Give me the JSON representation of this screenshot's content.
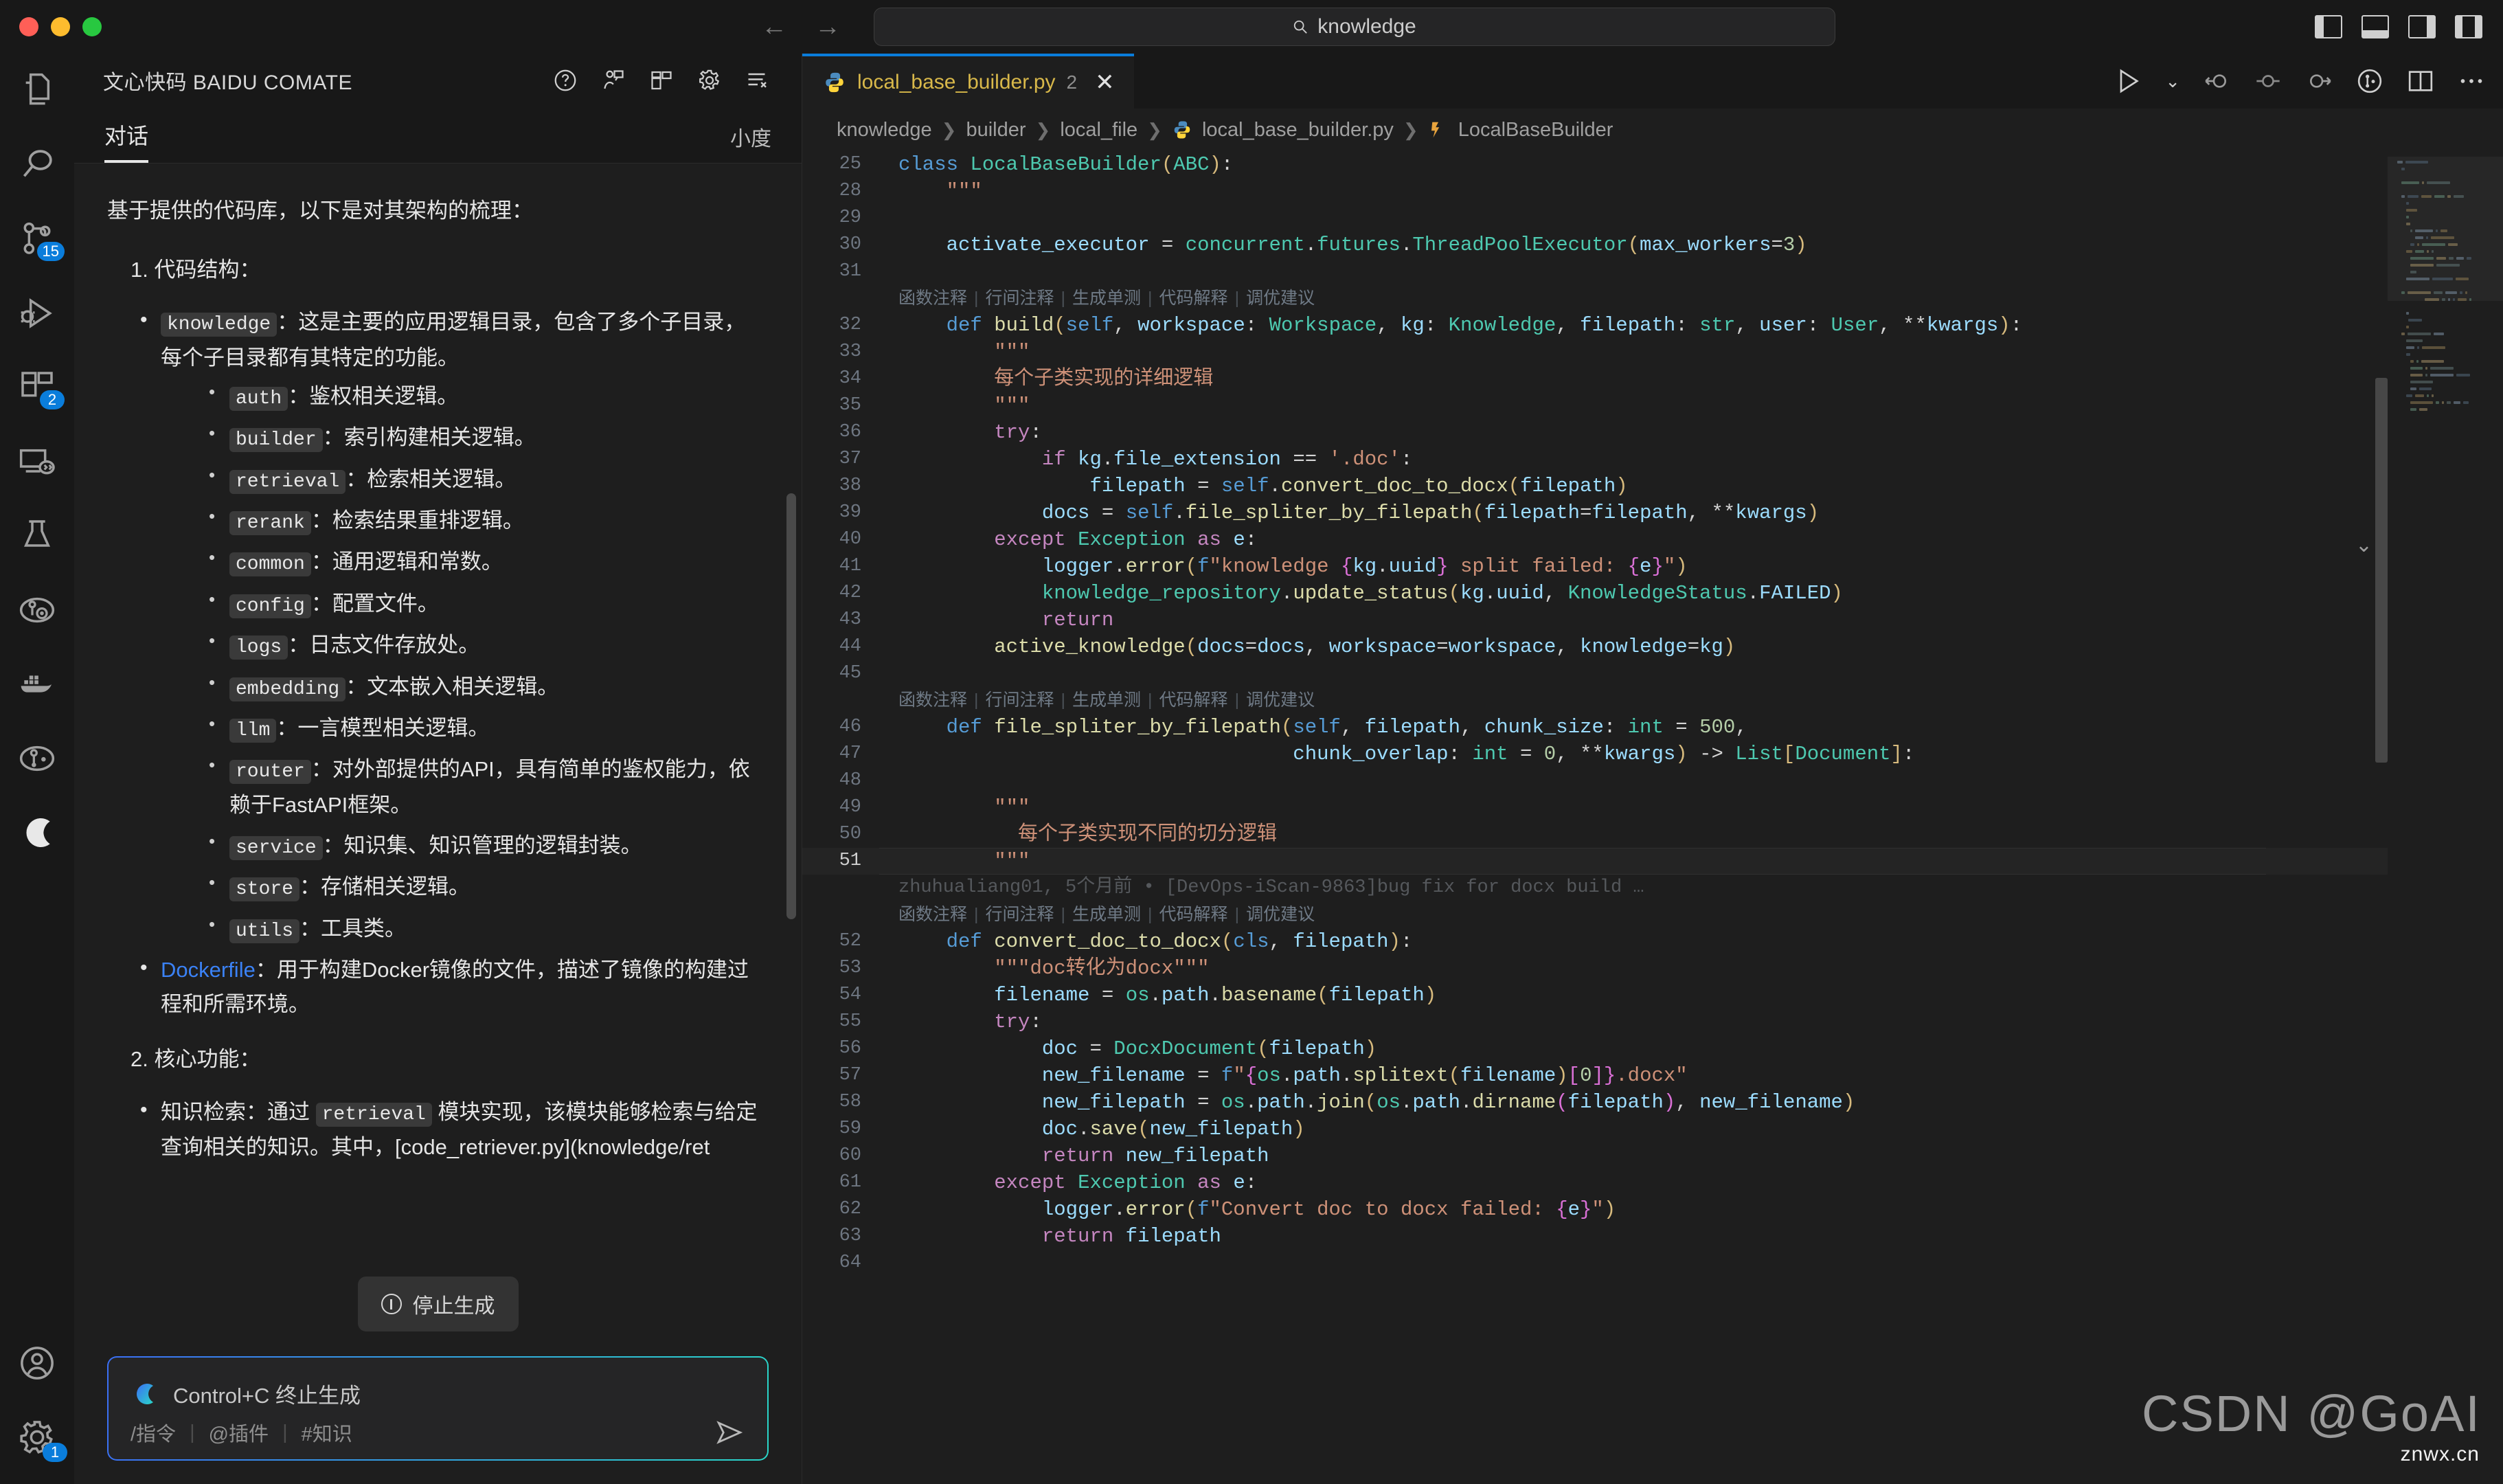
{
  "window": {
    "traffic_lights": [
      "close",
      "minimize",
      "maximize"
    ],
    "nav_back": "←",
    "nav_forward": "→",
    "command_bar": {
      "icon": "search-icon",
      "value": "knowledge"
    },
    "layout_controls": [
      "toggle-primary-sidebar",
      "toggle-panel",
      "toggle-secondary-sidebar",
      "customize-layout"
    ]
  },
  "activity_bar": {
    "items": [
      {
        "name": "explorer",
        "icon": "files-icon",
        "badge": ""
      },
      {
        "name": "search",
        "icon": "search-icon",
        "badge": ""
      },
      {
        "name": "source-control",
        "icon": "source-control-icon",
        "badge": "15"
      },
      {
        "name": "run-and-debug",
        "icon": "debug-icon",
        "badge": ""
      },
      {
        "name": "extensions",
        "icon": "extensions-icon",
        "badge": "2"
      },
      {
        "name": "remote-explorer",
        "icon": "remote-icon",
        "badge": ""
      },
      {
        "name": "testing",
        "icon": "beaker-icon",
        "badge": ""
      },
      {
        "name": "gitlens",
        "icon": "gitlens-icon",
        "badge": ""
      },
      {
        "name": "docker",
        "icon": "docker-icon",
        "badge": ""
      },
      {
        "name": "git-graph",
        "icon": "git-graph-icon",
        "badge": ""
      },
      {
        "name": "comate",
        "icon": "comate-logo-icon",
        "badge": ""
      }
    ],
    "bottom_items": [
      {
        "name": "accounts",
        "icon": "account-icon",
        "badge": ""
      },
      {
        "name": "manage",
        "icon": "gear-icon",
        "badge": "1"
      }
    ]
  },
  "side_panel": {
    "header": {
      "title": "文心快码 BAIDU COMATE",
      "icons": [
        "help-icon",
        "feedback-icon",
        "layout-icon",
        "gear-icon",
        "clear-list-icon"
      ]
    },
    "tabs": {
      "active": "对话",
      "right_label": "小度"
    },
    "conversation": {
      "intro": "基于提供的代码库，以下是对其架构的梳理：",
      "section1_heading": "1. 代码结构：",
      "knowledge_item": {
        "code": "knowledge",
        "text": "：这是主要的应用逻辑目录，包含了多个子目录，每个子目录都有其特定的功能。",
        "children": [
          {
            "code": "auth",
            "text": "：鉴权相关逻辑。"
          },
          {
            "code": "builder",
            "text": "：索引构建相关逻辑。"
          },
          {
            "code": "retrieval",
            "text": "：检索相关逻辑。"
          },
          {
            "code": "rerank",
            "text": "：检索结果重排逻辑。"
          },
          {
            "code": "common",
            "text": "：通用逻辑和常数。"
          },
          {
            "code": "config",
            "text": "：配置文件。"
          },
          {
            "code": "logs",
            "text": "：日志文件存放处。"
          },
          {
            "code": "embedding",
            "text": "：文本嵌入相关逻辑。"
          },
          {
            "code": "llm",
            "text": "：一言模型相关逻辑。"
          },
          {
            "code": "router",
            "text": "：对外部提供的API，具有简单的鉴权能力，依赖于FastAPI框架。"
          },
          {
            "code": "service",
            "text": "：知识集、知识管理的逻辑封装。"
          },
          {
            "code": "store",
            "text": "：存储相关逻辑。"
          },
          {
            "code": "utils",
            "text": "：工具类。"
          }
        ]
      },
      "dockerfile_item": {
        "link": "Dockerfile",
        "text": "：用于构建Docker镜像的文件，描述了镜像的构建过程和所需环境。"
      },
      "section2_heading": "2. 核心功能：",
      "feature_item": {
        "prefix": "知识检索：通过 ",
        "code": "retrieval",
        "text": " 模块实现，该模块能够检索与给定查询相关的知识。其中，[code_retriever.py](knowledge/ret"
      }
    },
    "stop_button": {
      "label": "停止生成",
      "icon": "stop-circle-icon"
    },
    "input": {
      "placeholder": "Control+C 终止生成",
      "logo": "comate-logo-icon",
      "chips": [
        "/指令",
        "@插件",
        "#知识"
      ],
      "send_icon": "send-icon"
    }
  },
  "editor": {
    "tab": {
      "icon": "python-icon",
      "label": "local_base_builder.py",
      "count": "2",
      "close": "✕"
    },
    "actions": [
      "run-python-file",
      "chevron-down-icon",
      "step-back-icon",
      "step-into-icon",
      "step-over-icon",
      "gitlens-icon",
      "split-editor-icon",
      "more-actions-icon"
    ],
    "breadcrumb": [
      {
        "label": "knowledge",
        "icon": ""
      },
      {
        "label": "builder",
        "icon": ""
      },
      {
        "label": "local_file",
        "icon": ""
      },
      {
        "label": "local_base_builder.py",
        "icon": "python-icon"
      },
      {
        "label": "LocalBaseBuilder",
        "icon": "class-icon"
      }
    ],
    "codelens_actions": [
      "函数注释",
      "行间注释",
      "生成单测",
      "代码解释",
      "调优建议"
    ],
    "blame": "zhuhualiang01, 5个月前 • [DevOps-iScan-9863]bug fix for docx build  …",
    "lines": [
      {
        "n": "25",
        "html": "<span class=\"kw2\">class</span> <span class=\"cls\">LocalBaseBuilder</span><span class=\"par\">(</span><span class=\"cls\">ABC</span><span class=\"par\">)</span>:"
      },
      {
        "n": "28",
        "html": "    <span class=\"cmt\">\"\"\"</span>"
      },
      {
        "n": "29",
        "html": ""
      },
      {
        "n": "30",
        "html": "    <span class=\"var\">activate_executor</span> <span class=\"op\">=</span> <span class=\"cls\">concurrent</span>.<span class=\"cls\">futures</span>.<span class=\"cls\">ThreadPoolExecutor</span><span class=\"par\">(</span><span class=\"var\">max_workers</span><span class=\"op\">=</span><span class=\"num\">3</span><span class=\"par\">)</span>"
      },
      {
        "n": "31",
        "html": ""
      },
      {
        "lens": true
      },
      {
        "n": "32",
        "html": "    <span class=\"kw2\">def</span> <span class=\"fn\">build</span><span class=\"par\">(</span><span class=\"self\">self</span>, <span class=\"var\">workspace</span>: <span class=\"cls\">Workspace</span>, <span class=\"var\">kg</span>: <span class=\"cls\">Knowledge</span>, <span class=\"var\">filepath</span>: <span class=\"cls\">str</span>, <span class=\"var\">user</span>: <span class=\"cls\">User</span>, <span class=\"op\">**</span><span class=\"var\">kwargs</span><span class=\"par\">)</span>:"
      },
      {
        "n": "33",
        "html": "        <span class=\"cmt\">\"\"\"</span>"
      },
      {
        "n": "34",
        "html": "        <span class=\"cmt\">每个子类实现的详细逻辑</span>"
      },
      {
        "n": "35",
        "html": "        <span class=\"cmt\">\"\"\"</span>"
      },
      {
        "n": "36",
        "html": "        <span class=\"kw\">try</span>:"
      },
      {
        "n": "37",
        "html": "            <span class=\"kw\">if</span> <span class=\"var\">kg</span>.<span class=\"var\">file_extension</span> <span class=\"op\">==</span> <span class=\"str\">'.doc'</span>:"
      },
      {
        "n": "38",
        "html": "                <span class=\"var\">filepath</span> <span class=\"op\">=</span> <span class=\"self\">self</span>.<span class=\"fn\">convert_doc_to_docx</span><span class=\"par\">(</span><span class=\"var\">filepath</span><span class=\"par\">)</span>"
      },
      {
        "n": "39",
        "html": "            <span class=\"var\">docs</span> <span class=\"op\">=</span> <span class=\"self\">self</span>.<span class=\"fn\">file_spliter_by_filepath</span><span class=\"par\">(</span><span class=\"var\">filepath</span><span class=\"op\">=</span><span class=\"var\">filepath</span>, <span class=\"op\">**</span><span class=\"var\">kwargs</span><span class=\"par\">)</span>"
      },
      {
        "n": "40",
        "html": "        <span class=\"kw\">except</span> <span class=\"cls\">Exception</span> <span class=\"kw\">as</span> <span class=\"var\">e</span>:"
      },
      {
        "n": "41",
        "html": "            <span class=\"var\">logger</span>.<span class=\"fn\">error</span><span class=\"par\">(</span><span class=\"kw2\">f</span><span class=\"str\">\"knowledge </span><span class=\"par2\">{</span><span class=\"var\">kg</span>.<span class=\"var\">uuid</span><span class=\"par2\">}</span><span class=\"str\"> split failed: </span><span class=\"par2\">{</span><span class=\"var\">e</span><span class=\"par2\">}</span><span class=\"str\">\"</span><span class=\"par\">)</span>"
      },
      {
        "n": "42",
        "html": "            <span class=\"cls\">knowledge_repository</span>.<span class=\"fn\">update_status</span><span class=\"par\">(</span><span class=\"var\">kg</span>.<span class=\"var\">uuid</span>, <span class=\"cls\">KnowledgeStatus</span>.<span class=\"var\">FAILED</span><span class=\"par\">)</span>"
      },
      {
        "n": "43",
        "html": "            <span class=\"kw\">return</span>"
      },
      {
        "n": "44",
        "html": "        <span class=\"fn\">active_knowledge</span><span class=\"par\">(</span><span class=\"var\">docs</span><span class=\"op\">=</span><span class=\"var\">docs</span>, <span class=\"var\">workspace</span><span class=\"op\">=</span><span class=\"var\">workspace</span>, <span class=\"var\">knowledge</span><span class=\"op\">=</span><span class=\"var\">kg</span><span class=\"par\">)</span>"
      },
      {
        "n": "45",
        "html": ""
      },
      {
        "lens": true
      },
      {
        "n": "46",
        "html": "    <span class=\"kw2\">def</span> <span class=\"fn\">file_spliter_by_filepath</span><span class=\"par\">(</span><span class=\"self\">self</span>, <span class=\"var\">filepath</span>, <span class=\"var\">chunk_size</span>: <span class=\"cls\">int</span> <span class=\"op\">=</span> <span class=\"num\">500</span>,"
      },
      {
        "n": "47",
        "html": "                                 <span class=\"var\">chunk_overlap</span>: <span class=\"cls\">int</span> <span class=\"op\">=</span> <span class=\"num\">0</span>, <span class=\"op\">**</span><span class=\"var\">kwargs</span><span class=\"par\">)</span> <span class=\"op\">-></span> <span class=\"cls\">List</span><span class=\"par\">[</span><span class=\"cls\">Document</span><span class=\"par\">]</span>:"
      },
      {
        "n": "48",
        "html": ""
      },
      {
        "n": "49",
        "html": "        <span class=\"cmt\">\"\"\"</span>"
      },
      {
        "n": "50",
        "html": "          <span class=\"cmt\">每个子类实现不同的切分逻辑</span>"
      },
      {
        "n": "51",
        "html": "        <span class=\"cmt\">\"\"\"</span>",
        "current": true,
        "blame": true
      },
      {
        "lens": true
      },
      {
        "n": "52",
        "html": "    <span class=\"kw2\">def</span> <span class=\"fn\">convert_doc_to_docx</span><span class=\"par\">(</span><span class=\"self\">cls</span>, <span class=\"var\">filepath</span><span class=\"par\">)</span>:"
      },
      {
        "n": "53",
        "html": "        <span class=\"cmt\">\"\"\"doc转化为docx\"\"\"</span>"
      },
      {
        "n": "54",
        "html": "        <span class=\"var\">filename</span> <span class=\"op\">=</span> <span class=\"cls\">os</span>.<span class=\"var\">path</span>.<span class=\"fn\">basename</span><span class=\"par\">(</span><span class=\"var\">filepath</span><span class=\"par\">)</span>"
      },
      {
        "n": "55",
        "html": "        <span class=\"kw\">try</span>:"
      },
      {
        "n": "56",
        "html": "            <span class=\"var\">doc</span> <span class=\"op\">=</span> <span class=\"cls\">DocxDocument</span><span class=\"par\">(</span><span class=\"var\">filepath</span><span class=\"par\">)</span>"
      },
      {
        "n": "57",
        "html": "            <span class=\"var\">new_filename</span> <span class=\"op\">=</span> <span class=\"kw2\">f</span><span class=\"str\">\"</span><span class=\"par2\">{</span><span class=\"cls\">os</span>.<span class=\"var\">path</span>.<span class=\"fn\">splitext</span><span class=\"par\">(</span><span class=\"var\">filename</span><span class=\"par\">)</span><span class=\"par2\">[</span><span class=\"num\">0</span><span class=\"par2\">]</span><span class=\"par2\">}</span><span class=\"str\">.docx\"</span>"
      },
      {
        "n": "58",
        "html": "            <span class=\"var\">new_filepath</span> <span class=\"op\">=</span> <span class=\"cls\">os</span>.<span class=\"var\">path</span>.<span class=\"fn\">join</span><span class=\"par\">(</span><span class=\"cls\">os</span>.<span class=\"var\">path</span>.<span class=\"fn\">dirname</span><span class=\"par2\">(</span><span class=\"var\">filepath</span><span class=\"par2\">)</span>, <span class=\"var\">new_filename</span><span class=\"par\">)</span>"
      },
      {
        "n": "59",
        "html": "            <span class=\"var\">doc</span>.<span class=\"fn\">save</span><span class=\"par\">(</span><span class=\"var\">new_filepath</span><span class=\"par\">)</span>"
      },
      {
        "n": "60",
        "html": "            <span class=\"kw\">return</span> <span class=\"var\">new_filepath</span>"
      },
      {
        "n": "61",
        "html": "        <span class=\"kw\">except</span> <span class=\"cls\">Exception</span> <span class=\"kw\">as</span> <span class=\"var\">e</span>:"
      },
      {
        "n": "62",
        "html": "            <span class=\"var\">logger</span>.<span class=\"fn\">error</span><span class=\"par\">(</span><span class=\"kw2\">f</span><span class=\"str\">\"Convert doc to docx failed: </span><span class=\"par2\">{</span><span class=\"var\">e</span><span class=\"par2\">}</span><span class=\"str\">\"</span><span class=\"par\">)</span>"
      },
      {
        "n": "63",
        "html": "            <span class=\"kw\">return</span> <span class=\"var\">filepath</span>"
      },
      {
        "n": "64",
        "html": ""
      }
    ]
  },
  "watermark": {
    "text": "CSDN @GoAI",
    "sub": "znwx.cn"
  },
  "colors": {
    "accent": "#0a7ddb",
    "tab_label": "#d8b84a",
    "link": "#3b82f6",
    "editor_bg": "#1e1e1e",
    "chrome_bg": "#181818"
  }
}
